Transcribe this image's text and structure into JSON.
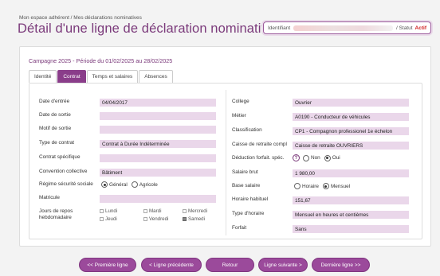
{
  "header": {
    "breadcrumb": "Mon espace adhérent / Mes déclarations nominatives",
    "title": "Détail d'une ligne de déclaration nominative",
    "ident_label": "Identifiant",
    "status_label": "/ Statut",
    "status_value": "Actif"
  },
  "campaign": "Campagne 2025 - Période du 01/02/2025 au 28/02/2025",
  "tabs": [
    {
      "label": "Identité"
    },
    {
      "label": "Contrat"
    },
    {
      "label": "Temps et salaires"
    },
    {
      "label": "Absences"
    }
  ],
  "left": {
    "date_entree": {
      "label": "Date d'entrée",
      "value": "04/04/2017"
    },
    "date_sortie": {
      "label": "Date de sortie",
      "value": ""
    },
    "motif_sortie": {
      "label": "Motif de sortie",
      "value": ""
    },
    "type_contrat": {
      "label": "Type de contrat",
      "value": "Contrat à Durée Indéterminée"
    },
    "contrat_specifique": {
      "label": "Contrat spécifique",
      "value": ""
    },
    "convention": {
      "label": "Convention collective",
      "value": "Bâtiment"
    },
    "regime": {
      "label": "Régime sécurité sociale",
      "opt1": "Général",
      "opt2": "Agricole"
    },
    "matricule": {
      "label": "Matricule"
    },
    "jours_repos": {
      "label1": "Jours de repos",
      "label2": "hebdomadaire",
      "days": [
        "Lundi",
        "Mardi",
        "Mercredi",
        "Jeudi",
        "Vendredi",
        "Samedi"
      ]
    }
  },
  "right": {
    "college": {
      "label": "College",
      "value": "Ouvrier"
    },
    "metier": {
      "label": "Métier",
      "value": "A0190 - Conducteur de véhicules"
    },
    "classification": {
      "label": "Classification",
      "value": "CP1 - Compagnon professionel 1e échelon"
    },
    "caisse": {
      "label": "Caisse de retraite compl",
      "value": "Caisse de retraite OUVRIERS"
    },
    "deduction": {
      "label": "Déduction forfait. spéc.",
      "help": "?",
      "opt1": "Non",
      "opt2": "Oui"
    },
    "salaire_brut": {
      "label": "Salaire brut",
      "value": "1 980,00"
    },
    "base_salaire": {
      "label": "Base salaire",
      "opt1": "Horaire",
      "opt2": "Mensuel"
    },
    "horaire": {
      "label": "Horaire habituel",
      "value": "151,67"
    },
    "type_horaire": {
      "label": "Type d'horaire",
      "value": "Mensuel en heures et centièmes"
    },
    "forfait": {
      "label": "Forfait",
      "value": "Sans"
    }
  },
  "nav": {
    "first": "<< Première ligne",
    "prev": "< Ligne précédente",
    "back": "Retour",
    "next": "Ligne suivante >",
    "last": "Dernière ligne >>"
  }
}
